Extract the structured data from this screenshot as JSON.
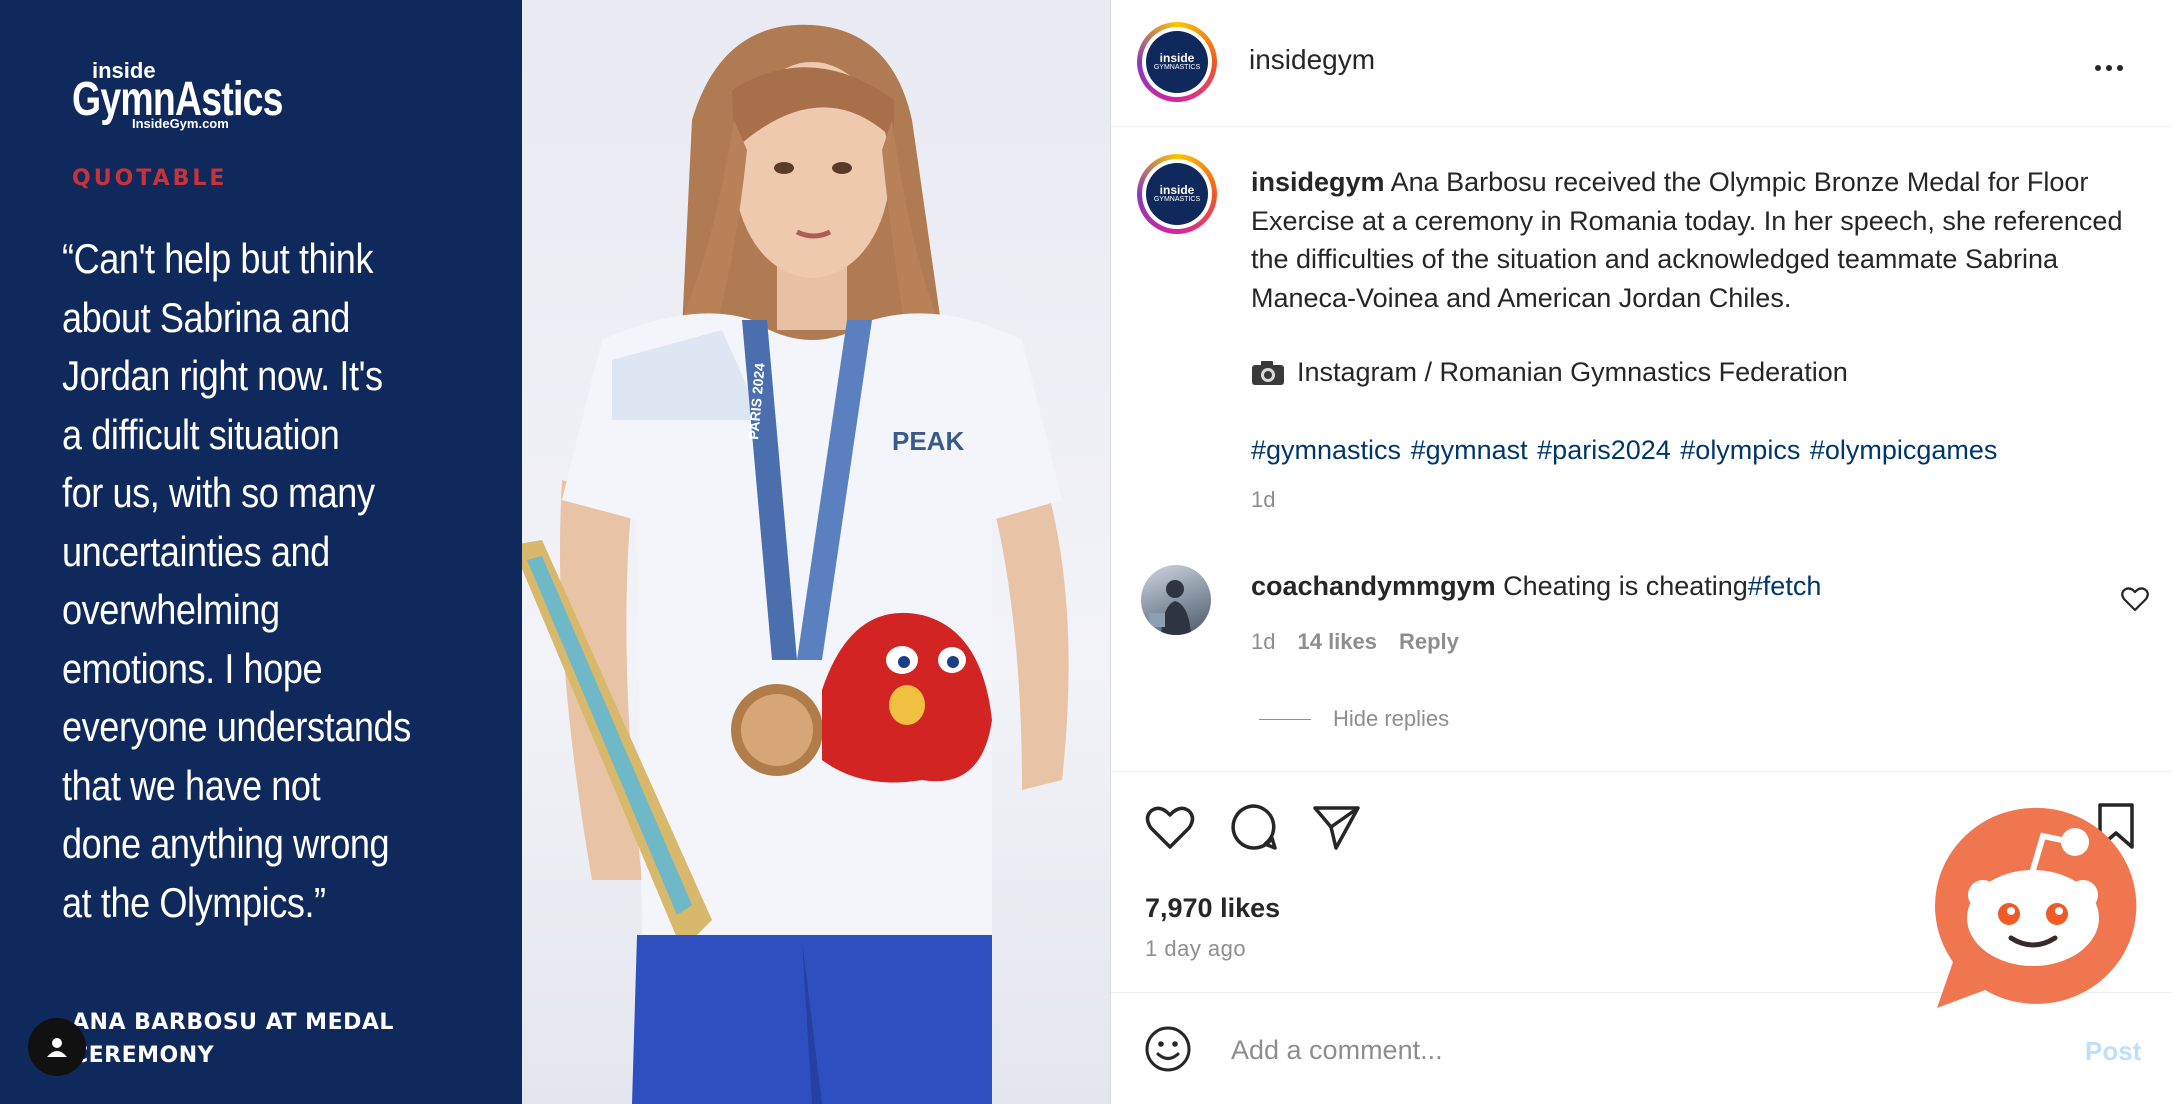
{
  "brand": {
    "inside": "inside",
    "main": "GymnAstics",
    "sub": "InsideGym.com"
  },
  "quote_panel": {
    "label": "QUOTABLE",
    "quote": "“Can't help but think\nabout Sabrina and\nJordan right now. It's\na difficult situation\nfor us, with so many\nuncertainties and\noverwhelming\nemotions. I hope\neveryone understands\nthat we have not\ndone anything wrong\nat the Olympics.”",
    "attribution": "ANA BARBOSU AT MEDAL CEREMONY"
  },
  "photo": {
    "shirt_logo": "PEAK",
    "lanyard_text": "PARIS 2024"
  },
  "avatar": {
    "line1": "inside",
    "line2": "GYMNASTICS"
  },
  "header": {
    "username": "insidegym"
  },
  "caption": {
    "username": "insidegym",
    "text": "Ana Barbosu received the Olympic Bronze Medal for Floor Exercise at a ceremony in Romania today. In her speech, she referenced the difficulties of the situation and acknowledged teammate Sabrina Maneca-Voinea and American Jordan Chiles.",
    "credit": "Instagram / Romanian Gymnastics Federation",
    "hashtags": [
      "#gymnastics",
      "#gymnast",
      "#paris2024",
      "#olympics",
      "#olympicgames"
    ],
    "age": "1d"
  },
  "comment": {
    "username": "coachandymmgym",
    "text": "Cheating is cheating",
    "tag": "#fetch",
    "age": "1d",
    "likes": "14 likes",
    "reply": "Reply",
    "hide_replies": "Hide replies"
  },
  "stats": {
    "likes": "7,970 likes",
    "timestamp": "1 day ago"
  },
  "composer": {
    "placeholder": "Add a comment...",
    "post_label": "Post"
  },
  "colors": {
    "navy": "#10295c",
    "quotable_red": "#c8323a",
    "hashtag_blue": "#00376b",
    "reddit_orange": "#f07650"
  }
}
